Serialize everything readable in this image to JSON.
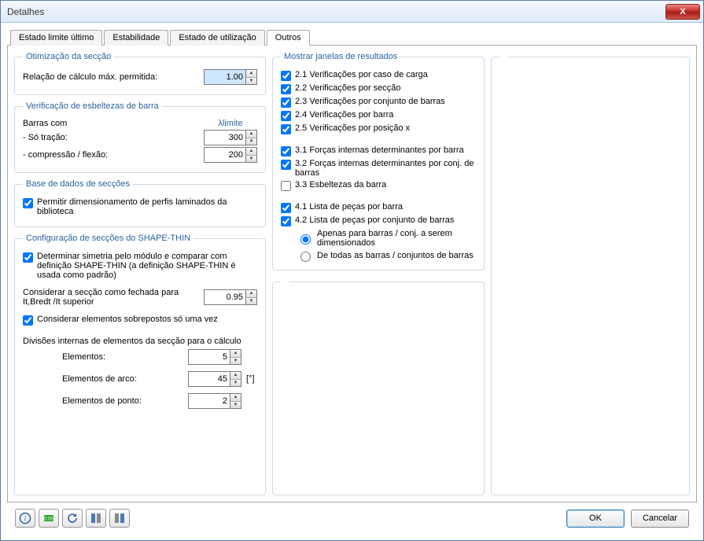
{
  "window": {
    "title": "Detalhes",
    "close_glyph": "X"
  },
  "tabs": [
    {
      "label": "Estado limite último"
    },
    {
      "label": "Estabilidade"
    },
    {
      "label": "Estado de utilização"
    },
    {
      "label": "Outros"
    }
  ],
  "opt": {
    "legend": "Otimização da secção",
    "ratio_label": "Relação de cálculo máx. permitida:",
    "ratio_value": "1.00"
  },
  "slender": {
    "legend": "Verificação de esbeltezas de barra",
    "bars_with": "Barras com",
    "lambda_header": "λlimite",
    "tension_label": "- Só tração:",
    "tension_value": "300",
    "compr_label": "- compressão / flexão:",
    "compr_value": "200"
  },
  "db": {
    "legend": "Base de dados de secções",
    "allow_label": "Permitir dimensionamento de perfis laminados da biblioteca"
  },
  "shapethin": {
    "legend": "Configuração de secções do SHAPE-THIN",
    "sym_label": "Determinar simetria pelo módulo e comparar com definição SHAPE-THIN (a definição SHAPE-THIN é usada como padrão)",
    "closed_label": "Considerar a secção como fechada para It,Bredt /It superior",
    "closed_value": "0.95",
    "overlap_label": "Considerar elementos sobrepostos só uma vez",
    "divisions_header": "Divisões internas de elementos da secção para o cálculo",
    "elements_label": "Elementos:",
    "elements_value": "5",
    "arc_label": "Elementos de arco:",
    "arc_value": "45",
    "arc_unit": "[°]",
    "point_label": "Elementos de ponto:",
    "point_value": "2"
  },
  "results": {
    "legend": "Mostrar janelas de resultados",
    "r21": "2.1 Verificações por caso de carga",
    "r22": "2.2 Verificações por secção",
    "r23": "2.3 Verificações por conjunto de barras",
    "r24": "2.4 Verificações por barra",
    "r25": "2.5 Verificações por posição x",
    "r31": "3.1 Forças internas determinantes por barra",
    "r32": "3.2 Forças internas determinantes por conj. de barras",
    "r33": "3.3 Esbeltezas da barra",
    "r41": "4.1 Lista de peças por barra",
    "r42": "4.2 Lista de peças por conjunto de barras",
    "opt_a": "Apenas para barras / conj. a serem dimensionados",
    "opt_b": "De todas as barras / conjuntos de barras"
  },
  "footer": {
    "ok": "OK",
    "cancel": "Cancelar"
  }
}
